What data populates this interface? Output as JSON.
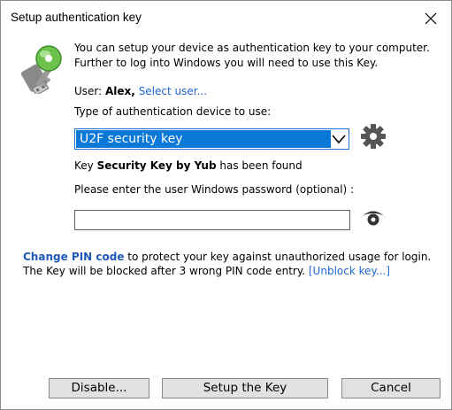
{
  "window": {
    "title": "Setup authentication key"
  },
  "intro": {
    "line1": "You can setup your device as authentication key to your computer.",
    "line2": "Further to log into Windows you will need to use this Key."
  },
  "user": {
    "label": "User:",
    "name": "Alex,",
    "select_link": "Select user..."
  },
  "device_type": {
    "label": "Type of authentication device to use:",
    "selected": "U2F security key"
  },
  "key_found": {
    "prefix": "Key",
    "name": "Security Key by Yub",
    "suffix": "has been found"
  },
  "password": {
    "label": "Please enter the user Windows password (optional) :",
    "value": ""
  },
  "pin": {
    "link": "Change PIN code",
    "text1": "to protect your key against unauthorized usage for login.",
    "text2": "The Key will be blocked after 3 wrong PIN code entry.",
    "unblock_link": "[Unblock key...]"
  },
  "buttons": {
    "disable": "Disable...",
    "setup": "Setup the Key",
    "cancel": "Cancel"
  },
  "icons": {
    "close": "close-icon",
    "key": "key-icon",
    "gear": "gear-icon",
    "eye": "eye-icon",
    "dropdown": "chevron-down-icon"
  },
  "colors": {
    "accent": "#0a78d7",
    "link": "#1e66d3",
    "pin_link": "#1e58b8",
    "key_green": "#6cc24a"
  }
}
